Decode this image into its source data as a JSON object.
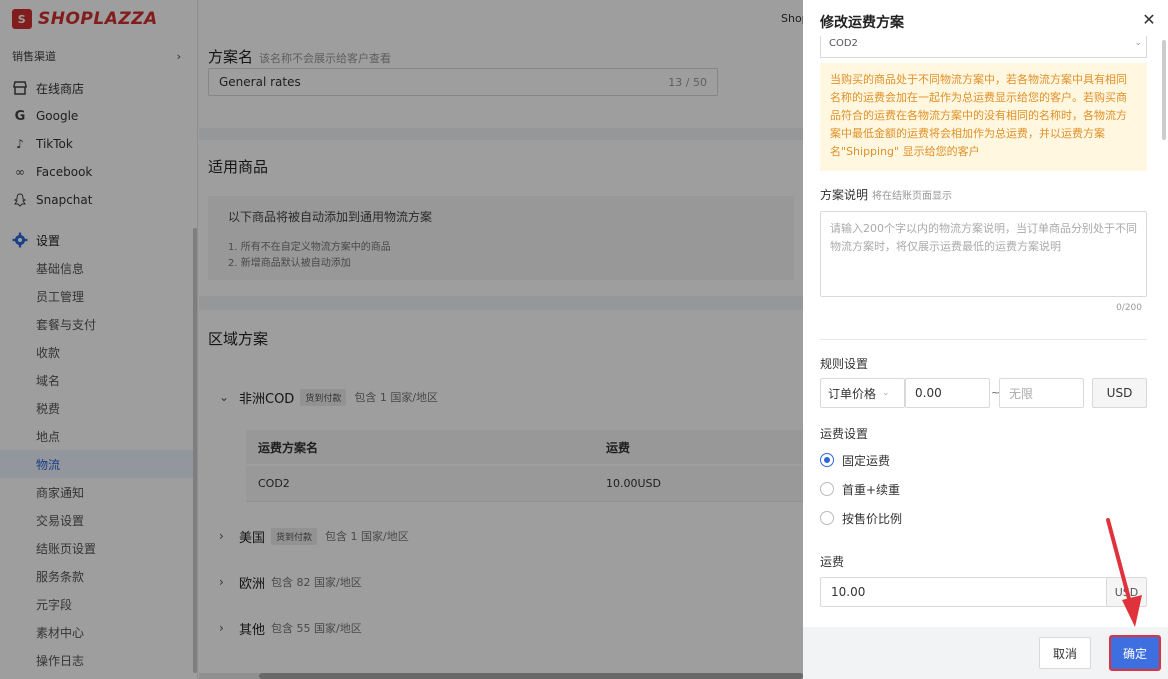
{
  "sidebar": {
    "brand": "SHOPLAZZA",
    "sales_channel_label": "销售渠道",
    "channels": [
      {
        "label": "在线商店",
        "icon": "store-icon"
      },
      {
        "label": "Google",
        "icon": "google-icon"
      },
      {
        "label": "TikTok",
        "icon": "tiktok-icon"
      },
      {
        "label": "Facebook",
        "icon": "meta-icon"
      },
      {
        "label": "Snapchat",
        "icon": "snapchat-icon"
      }
    ],
    "settings_label": "设置",
    "settings_items": [
      "基础信息",
      "员工管理",
      "套餐与支付",
      "收款",
      "域名",
      "税费",
      "地点",
      "物流",
      "商家通知",
      "交易设置",
      "结账页设置",
      "服务条款",
      "元字段",
      "素材中心",
      "操作日志"
    ],
    "active_item": "物流"
  },
  "topbar": {
    "shop_label": "Shop"
  },
  "main": {
    "plan_name_label": "方案名",
    "plan_name_hint": "该名称不会展示给客户查看",
    "plan_name_value": "General rates",
    "plan_name_count": "13 / 50",
    "products_title": "适用商品",
    "products_notice": "以下商品将被自动添加到通用物流方案",
    "products_lines": [
      "1. 所有不在自定义物流方案中的商品",
      "2. 新增商品默认被自动添加"
    ],
    "zones_title": "区域方案",
    "zones": [
      {
        "name": "非洲COD",
        "tag": "货到付款",
        "meta": "包含 1 国家/地区",
        "expanded": true
      },
      {
        "name": "美国",
        "tag": "货到付款",
        "meta": "包含 1 国家/地区",
        "expanded": false
      },
      {
        "name": "欧洲",
        "tag": "",
        "meta": "包含 82 国家/地区",
        "expanded": false
      },
      {
        "name": "其他",
        "tag": "",
        "meta": "包含 55 国家/地区",
        "expanded": false
      }
    ],
    "table_headers": [
      "运费方案名",
      "运费"
    ],
    "table_rows": [
      [
        "COD2",
        "10.00USD"
      ]
    ]
  },
  "drawer": {
    "title": "修改运费方案",
    "top_select_value": "COD2",
    "warning": "当购买的商品处于不同物流方案中，若各物流方案中具有相同名称的运费会加在一起作为总运费显示给您的客户。若购买商品符合的运费在各物流方案中的没有相同的名称时，各物流方案中最低金额的运费将会相加作为总运费，并以运费方案名\"Shipping\" 显示给您的客户",
    "desc_label": "方案说明",
    "desc_hint": "将在结账页面显示",
    "desc_placeholder": "请输入200个字以内的物流方案说明，当订单商品分别处于不同物流方案时，将仅展示运费最低的运费方案说明",
    "desc_count": "0/200",
    "rule_label": "规则设置",
    "rule_type": "订单价格",
    "rule_min": "0.00",
    "rule_tilde": "~",
    "rule_max_placeholder": "无限",
    "rule_currency": "USD",
    "fee_label": "运费设置",
    "fee_options": [
      {
        "label": "固定运费",
        "checked": true
      },
      {
        "label": "首重+续重",
        "checked": false
      },
      {
        "label": "按售价比例",
        "checked": false
      }
    ],
    "cost_label": "运费",
    "cost_value": "10.00",
    "cost_unit": "USD",
    "cancel_label": "取消",
    "ok_label": "确定"
  },
  "colors": {
    "brand_red": "#d0302f",
    "primary_blue": "#3d6fe0",
    "warning_text": "#e0902a",
    "warning_bg": "#fff7df",
    "highlight_red": "#e0323a"
  }
}
